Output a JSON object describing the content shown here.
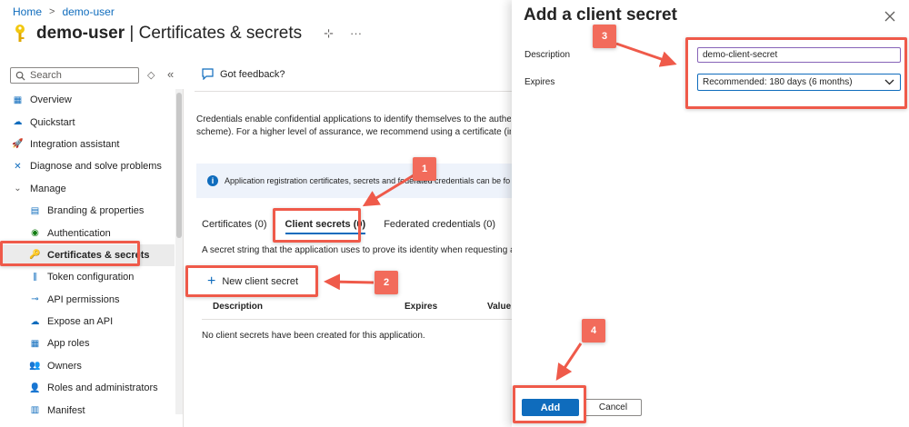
{
  "breadcrumb": {
    "home": "Home",
    "separator": ">",
    "current": "demo-user"
  },
  "header": {
    "app_name": "demo-user",
    "page_name": " | Certificates & secrets",
    "pin_glyph": "⊹",
    "more_glyph": "···"
  },
  "sidebar": {
    "search_placeholder": "Search",
    "collapse_glyph": "«",
    "options_glyph": "◇",
    "items": [
      {
        "label": "Overview",
        "icon": "grid-icon",
        "glyph": "▦",
        "color": "#0f6cbd"
      },
      {
        "label": "Quickstart",
        "icon": "cloud-icon",
        "glyph": "☁",
        "color": "#0f6cbd"
      },
      {
        "label": "Integration assistant",
        "icon": "rocket-icon",
        "glyph": "🚀",
        "color": "#d83b01"
      },
      {
        "label": "Diagnose and solve problems",
        "icon": "wrench-icon",
        "glyph": "✕",
        "color": "#0f6cbd"
      },
      {
        "label": "Manage",
        "icon": "chevron-down-icon",
        "glyph": "⌄",
        "color": "#605e5c"
      },
      {
        "label": "Branding & properties",
        "icon": "branding-icon",
        "glyph": "▤",
        "color": "#0f6cbd"
      },
      {
        "label": "Authentication",
        "icon": "auth-icon",
        "glyph": "◉",
        "color": "#107c10"
      },
      {
        "label": "Certificates & secrets",
        "icon": "key-icon",
        "glyph": "🔑",
        "color": "#e8b600"
      },
      {
        "label": "Token configuration",
        "icon": "token-icon",
        "glyph": "⫼",
        "color": "#0f6cbd"
      },
      {
        "label": "API permissions",
        "icon": "permissions-icon",
        "glyph": "⊸",
        "color": "#0f6cbd"
      },
      {
        "label": "Expose an API",
        "icon": "expose-icon",
        "glyph": "☁",
        "color": "#0f6cbd"
      },
      {
        "label": "App roles",
        "icon": "roles-icon",
        "glyph": "▦",
        "color": "#0f6cbd"
      },
      {
        "label": "Owners",
        "icon": "owners-icon",
        "glyph": "👥",
        "color": "#0f6cbd"
      },
      {
        "label": "Roles and administrators",
        "icon": "admin-icon",
        "glyph": "👤",
        "color": "#107c10"
      },
      {
        "label": "Manifest",
        "icon": "manifest-icon",
        "glyph": "▥",
        "color": "#0f6cbd"
      }
    ]
  },
  "main": {
    "feedback": "Got feedback?",
    "description_line1": "Credentials enable confidential applications to identify themselves to the authen",
    "description_line2": "scheme). For a higher level of assurance, we recommend using a certificate (inst",
    "info_banner": "Application registration certificates, secrets and federated credentials can be fo",
    "tabs": [
      "Certificates (0)",
      "Client secrets (0)",
      "Federated credentials (0)"
    ],
    "secret_note": "A secret string that the application uses to prove its identity when requesting a",
    "new_secret_label": "New client secret",
    "table_columns": [
      "Description",
      "Expires",
      "Value"
    ],
    "empty_message": "No client secrets have been created for this application."
  },
  "panel": {
    "title": "Add a client secret",
    "description_label": "Description",
    "description_value": "demo-client-secret",
    "expires_label": "Expires",
    "expires_value": "Recommended: 180 days (6 months)",
    "add_label": "Add",
    "cancel_label": "Cancel"
  },
  "callouts": [
    "1",
    "2",
    "3",
    "4"
  ],
  "colors": {
    "accent": "#0f6cbd",
    "callout": "#ef5a4a"
  }
}
